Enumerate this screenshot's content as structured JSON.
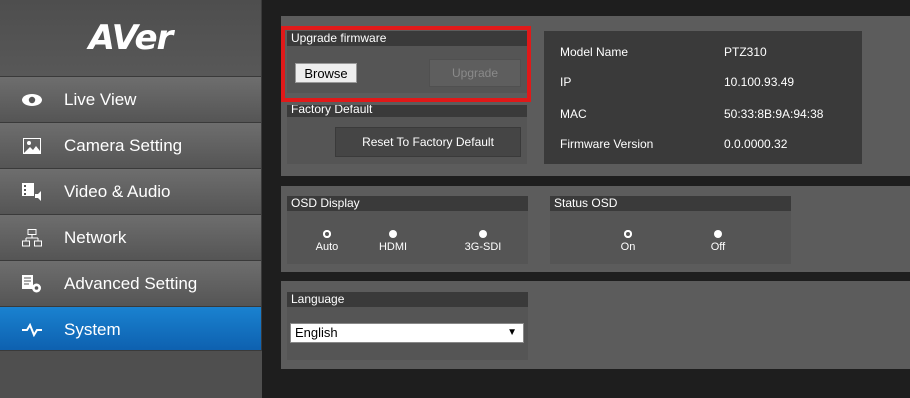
{
  "brand": {
    "logo_text": "AVer"
  },
  "sidebar": {
    "items": [
      {
        "label": "Live View",
        "icon": "eye-icon"
      },
      {
        "label": "Camera Setting",
        "icon": "image-icon"
      },
      {
        "label": "Video & Audio",
        "icon": "video-audio-icon"
      },
      {
        "label": "Network",
        "icon": "network-icon"
      },
      {
        "label": "Advanced Setting",
        "icon": "advanced-setting-icon"
      },
      {
        "label": "System",
        "icon": "pulse-icon",
        "active": true
      }
    ]
  },
  "firmware": {
    "title": "Upgrade firmware",
    "browse_label": "Browse",
    "upgrade_label": "Upgrade"
  },
  "factory": {
    "title": "Factory Default",
    "reset_label": "Reset To Factory Default"
  },
  "device_info": {
    "rows": [
      {
        "key": "Model Name",
        "value": "PTZ310"
      },
      {
        "key": "IP",
        "value": "10.100.93.49"
      },
      {
        "key": "MAC",
        "value": "50:33:8B:9A:94:38"
      },
      {
        "key": "Firmware Version",
        "value": "0.0.0000.32"
      }
    ]
  },
  "osd_display": {
    "title": "OSD Display",
    "options": [
      "Auto",
      "HDMI",
      "3G-SDI"
    ],
    "selected": "Auto"
  },
  "status_osd": {
    "title": "Status OSD",
    "options": [
      "On",
      "Off"
    ],
    "selected": "On"
  },
  "language": {
    "title": "Language",
    "selected": "English"
  },
  "colors": {
    "active_nav": "#0d6ec0",
    "highlight": "#e01919",
    "panel": "#5c5c5c"
  }
}
